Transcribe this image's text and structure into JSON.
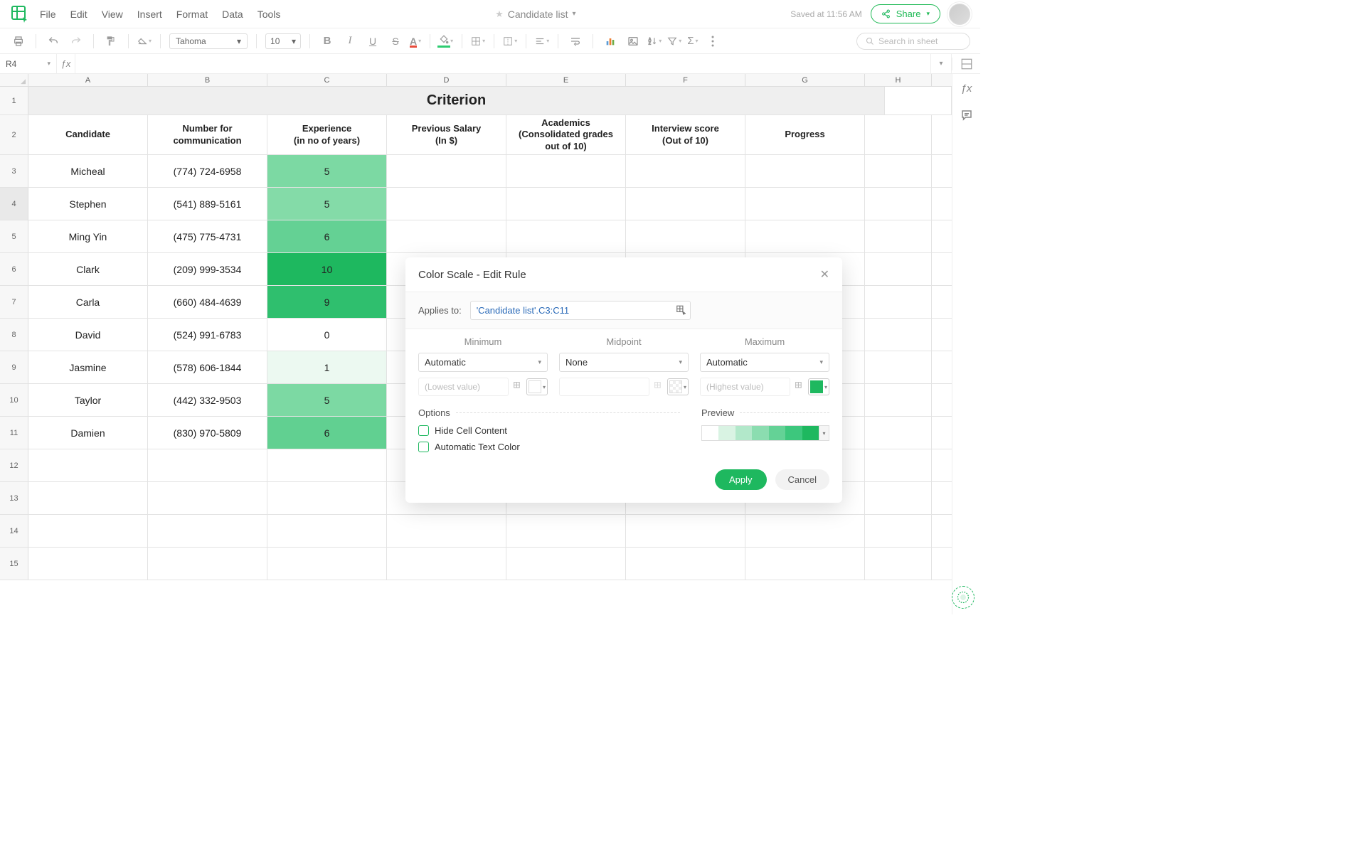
{
  "doc": {
    "title": "Candidate list",
    "saved": "Saved at 11:56 AM",
    "share": "Share"
  },
  "menu": {
    "file": "File",
    "edit": "Edit",
    "view": "View",
    "insert": "Insert",
    "format": "Format",
    "data": "Data",
    "tools": "Tools"
  },
  "toolbar": {
    "font": "Tahoma",
    "size": "10",
    "search_ph": "Search in sheet"
  },
  "namebox": {
    "ref": "R4"
  },
  "columns": {
    "a": "A",
    "b": "B",
    "c": "C",
    "d": "D",
    "e": "E",
    "f": "F",
    "g": "G",
    "h": "H"
  },
  "rows": {
    "labels": [
      "1",
      "2",
      "3",
      "4",
      "5",
      "6",
      "7",
      "8",
      "9",
      "10",
      "11",
      "12",
      "13",
      "14",
      "15"
    ],
    "title": "Criterion",
    "headers": {
      "candidate": "Candidate",
      "number": "Number for communication",
      "exp": "Experience\n(in no of years)",
      "salary": "Previous Salary\n(In $)",
      "academics": "Academics\n(Consolidated grades out of 10)",
      "interview": "Interview score\n(Out of 10)",
      "progress": "Progress"
    },
    "data": [
      {
        "name": "Micheal",
        "num": "(774) 724-6958",
        "exp": "5",
        "cls": "cs5"
      },
      {
        "name": "Stephen",
        "num": "(541) 889-5161",
        "exp": "5",
        "cls": "cs5b"
      },
      {
        "name": "Ming Yin",
        "num": "(475) 775-4731",
        "exp": "6",
        "cls": "cs6"
      },
      {
        "name": "Clark",
        "num": "(209) 999-3534",
        "exp": "10",
        "cls": "cs10"
      },
      {
        "name": "Carla",
        "num": "(660) 484-4639",
        "exp": "9",
        "cls": "cs9"
      },
      {
        "name": "David",
        "num": "(524) 991-6783",
        "exp": "0",
        "cls": "cs0"
      },
      {
        "name": "Jasmine",
        "num": "(578) 606-1844",
        "exp": "1",
        "cls": "cs1"
      },
      {
        "name": "Taylor",
        "num": "(442) 332-9503",
        "exp": "5",
        "cls": "cs5"
      },
      {
        "name": "Damien",
        "num": "(830) 970-5809",
        "exp": "6",
        "cls": "cs6b"
      }
    ]
  },
  "dialog": {
    "title": "Color Scale - Edit Rule",
    "applies_label": "Applies to:",
    "applies_value": "'Candidate list'.C3:C11",
    "min_label": "Minimum",
    "mid_label": "Midpoint",
    "max_label": "Maximum",
    "min_dd": "Automatic",
    "mid_dd": "None",
    "max_dd": "Automatic",
    "min_ph": "(Lowest value)",
    "max_ph": "(Highest value)",
    "options_label": "Options",
    "preview_label": "Preview",
    "opt_hide": "Hide Cell Content",
    "opt_auto_color": "Automatic Text Color",
    "apply": "Apply",
    "cancel": "Cancel"
  }
}
